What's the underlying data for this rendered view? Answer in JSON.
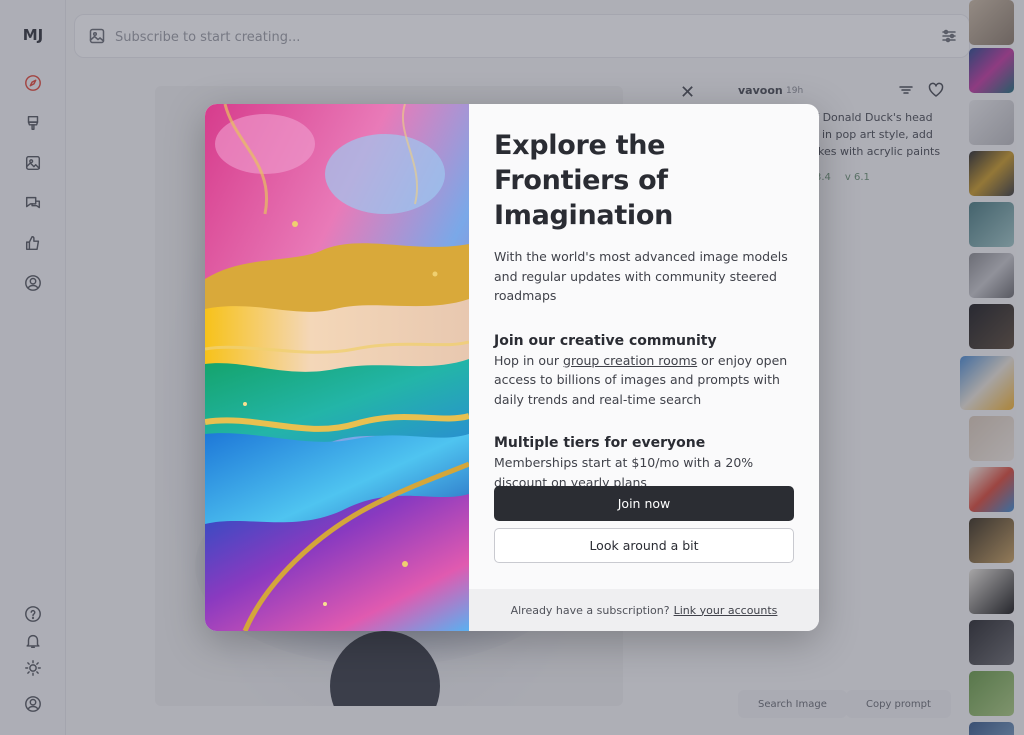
{
  "app": {
    "logo": "MJ",
    "accent_color": "#e0483a"
  },
  "sidebar": {
    "items": [
      {
        "icon": "compass-icon",
        "active": true
      },
      {
        "icon": "brush-icon"
      },
      {
        "icon": "image-icon"
      },
      {
        "icon": "chat-icon"
      },
      {
        "icon": "thumbs-up-icon"
      },
      {
        "icon": "user-circle-icon"
      }
    ],
    "bottom_items": [
      {
        "icon": "help-icon"
      },
      {
        "icon": "bell-icon"
      },
      {
        "icon": "sun-icon"
      },
      {
        "icon": "account-icon"
      }
    ]
  },
  "search": {
    "placeholder": "Subscribe to start creating..."
  },
  "detail": {
    "username": "vavoon",
    "time": "19h",
    "prompt_lines": [
      "g of Donald Duck's head",
      "in pop art style, add",
      "kes with acrylic paints"
    ],
    "param_1": "3.4",
    "param_2": "v 6.1",
    "search_image_label": "Search Image",
    "copy_prompt_label": "Copy prompt"
  },
  "modal": {
    "title": "Explore the Frontiers of Imagination",
    "intro": "With the world's most advanced image models and regular updates with community steered roadmaps",
    "features": [
      {
        "title": "Join our creative community",
        "text_before": "Hop in our ",
        "link": "group creation rooms",
        "text_after": " or enjoy open access to billions of images and prompts with daily trends and real-time search"
      },
      {
        "title": "Multiple tiers for everyone",
        "text": "Memberships start at $10/mo with a 20% discount on yearly plans"
      }
    ],
    "primary_button": "Join now",
    "secondary_button": "Look around a bit",
    "footer_text": "Already have a subscription?",
    "footer_link": "Link your accounts"
  }
}
